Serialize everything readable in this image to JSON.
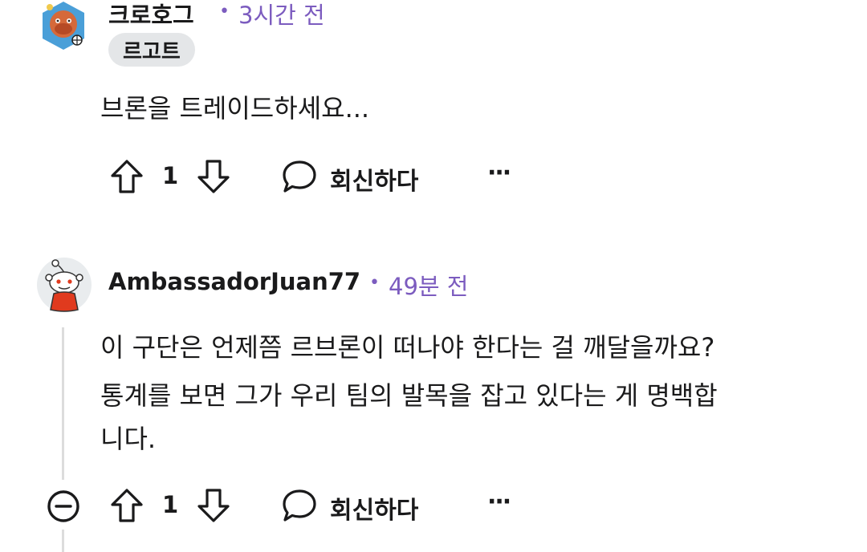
{
  "comments": [
    {
      "username": "크로호그",
      "separator": "•",
      "time": "3시간 전",
      "flair": "르고트",
      "body": "브론을 트레이드하세요...",
      "upvotes": "1",
      "reply_label": "회신하다",
      "more_label": "···",
      "avatar_icon": "snoo-avatar-icon"
    },
    {
      "username": "AmbassadorJuan77",
      "separator": "•",
      "time": "49분 전",
      "body_lines": [
        "이 구단은 언제쯤 르브론이 떠나야 한다는 걸 깨달을까요?",
        "통계를 보면 그가 우리 팀의 발목을 잡고 있다는 게 명백합",
        "니다."
      ],
      "upvotes": "1",
      "reply_label": "회신하다",
      "more_label": "···",
      "avatar_icon": "snoo-avatar-icon"
    }
  ],
  "colors": {
    "accent": "#7c5cbf",
    "text": "#1a1a1b",
    "flair_bg": "#e4e6e8",
    "thread_line": "#dcdcdc"
  }
}
